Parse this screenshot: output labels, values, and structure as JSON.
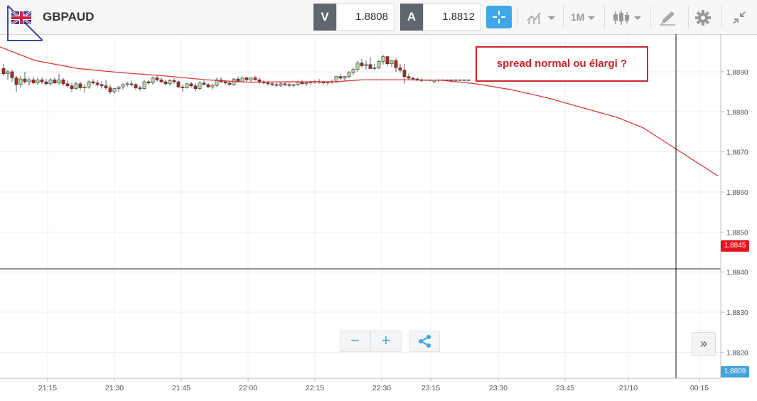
{
  "toolbar": {
    "symbol": "GBPAUD",
    "sell_tag": "V",
    "sell_price": "1.8808",
    "buy_tag": "A",
    "buy_price": "1.8812",
    "timeframe": "1M",
    "accent_color": "#3ea8e6"
  },
  "icons": [
    "uk-flag-icon",
    "crosshair-icon",
    "chart-type-icon",
    "candlestick-icon",
    "drawing-tool-icon",
    "gear-icon",
    "collapse-icon",
    "zoom-out-icon",
    "zoom-in-icon",
    "share-icon",
    "scroll-right-icon"
  ],
  "annotation": {
    "text": "spread normal ou élargi ?",
    "border_color": "#d0262d"
  },
  "zoom": {
    "minus": "−",
    "plus": "+"
  },
  "scroll_right": "»",
  "chart_data": {
    "type": "candlestick",
    "symbol": "GBPAUD",
    "timeframe": "1M",
    "x_tick_labels": [
      "21:15",
      "21:30",
      "21:45",
      "22:00",
      "22:15",
      "22:30",
      "23:15",
      "23:30",
      "23:45",
      "21/10",
      "00:15"
    ],
    "y_tick_labels": [
      "1,8890",
      "1,8880",
      "1,8870",
      "1,8860",
      "1,8850",
      "1,8840",
      "1,8830",
      "1,8820"
    ],
    "ylim": [
      1.88135,
      1.88994
    ],
    "up_color": "#b7d9a8",
    "down_color": "#b0291b",
    "ma_color": "#e03a36",
    "candles": [
      [
        1.88908,
        1.8892,
        1.8889,
        1.88895
      ],
      [
        1.88895,
        1.88905,
        1.8888,
        1.889
      ],
      [
        1.889,
        1.88905,
        1.88875,
        1.88885
      ],
      [
        1.88885,
        1.8889,
        1.8885,
        1.88868
      ],
      [
        1.88868,
        1.8889,
        1.8886,
        1.88882
      ],
      [
        1.88882,
        1.889,
        1.8887,
        1.88875
      ],
      [
        1.88875,
        1.88885,
        1.88865,
        1.8888
      ],
      [
        1.8888,
        1.88888,
        1.8887,
        1.88872
      ],
      [
        1.88872,
        1.88885,
        1.88868,
        1.8888
      ],
      [
        1.8888,
        1.88886,
        1.8887,
        1.88875
      ],
      [
        1.88875,
        1.88882,
        1.88866,
        1.8887
      ],
      [
        1.8887,
        1.88884,
        1.88865,
        1.8888
      ],
      [
        1.8888,
        1.88886,
        1.8887,
        1.88872
      ],
      [
        1.88872,
        1.88895,
        1.88868,
        1.8888
      ],
      [
        1.8888,
        1.88884,
        1.88865,
        1.8887
      ],
      [
        1.8887,
        1.88878,
        1.8886,
        1.88865
      ],
      [
        1.88865,
        1.88872,
        1.8885,
        1.88858
      ],
      [
        1.88858,
        1.88875,
        1.88855,
        1.8887
      ],
      [
        1.8887,
        1.88875,
        1.88855,
        1.8886
      ],
      [
        1.8886,
        1.88868,
        1.88848,
        1.88862
      ],
      [
        1.88862,
        1.88878,
        1.88858,
        1.88875
      ],
      [
        1.88875,
        1.88882,
        1.88868,
        1.88872
      ],
      [
        1.88872,
        1.8888,
        1.88862,
        1.88868
      ],
      [
        1.88868,
        1.88876,
        1.88858,
        1.88865
      ],
      [
        1.88865,
        1.8888,
        1.88855,
        1.8886
      ],
      [
        1.8886,
        1.88868,
        1.88845,
        1.8885
      ],
      [
        1.8885,
        1.8886,
        1.88845,
        1.88858
      ],
      [
        1.88858,
        1.88865,
        1.8885,
        1.88862
      ],
      [
        1.88862,
        1.88872,
        1.88856,
        1.88868
      ],
      [
        1.88868,
        1.88876,
        1.88862,
        1.8887
      ],
      [
        1.8887,
        1.88878,
        1.88862,
        1.88868
      ],
      [
        1.88868,
        1.88872,
        1.88855,
        1.8886
      ],
      [
        1.8886,
        1.88865,
        1.88852,
        1.88858
      ],
      [
        1.88858,
        1.8888,
        1.88855,
        1.88875
      ],
      [
        1.88875,
        1.8888,
        1.88868,
        1.88872
      ],
      [
        1.88872,
        1.88888,
        1.88868,
        1.88885
      ],
      [
        1.88885,
        1.88892,
        1.88875,
        1.8888
      ],
      [
        1.8888,
        1.88886,
        1.88872,
        1.88875
      ],
      [
        1.88875,
        1.8888,
        1.88866,
        1.8887
      ],
      [
        1.8887,
        1.88882,
        1.88865,
        1.88878
      ],
      [
        1.88878,
        1.88884,
        1.8887,
        1.88875
      ],
      [
        1.88875,
        1.88878,
        1.8886,
        1.88862
      ],
      [
        1.88862,
        1.88868,
        1.8885,
        1.8886
      ],
      [
        1.8886,
        1.88872,
        1.88858,
        1.8887
      ],
      [
        1.8887,
        1.88875,
        1.8886,
        1.88865
      ],
      [
        1.88865,
        1.88872,
        1.88852,
        1.88858
      ],
      [
        1.88858,
        1.88876,
        1.88855,
        1.88872
      ],
      [
        1.88872,
        1.88878,
        1.88866,
        1.88868
      ],
      [
        1.88868,
        1.88872,
        1.8886,
        1.88862
      ],
      [
        1.88862,
        1.8887,
        1.88856,
        1.88866
      ],
      [
        1.88866,
        1.88885,
        1.88862,
        1.8888
      ],
      [
        1.8888,
        1.88886,
        1.88872,
        1.88875
      ],
      [
        1.88875,
        1.8888,
        1.88868,
        1.88872
      ],
      [
        1.88872,
        1.88876,
        1.88866,
        1.88868
      ],
      [
        1.88868,
        1.88884,
        1.88865,
        1.88882
      ],
      [
        1.88882,
        1.88888,
        1.88872,
        1.88875
      ],
      [
        1.88875,
        1.88888,
        1.88872,
        1.88885
      ],
      [
        1.88885,
        1.88888,
        1.88876,
        1.8888
      ],
      [
        1.8888,
        1.88886,
        1.88874,
        1.88885
      ],
      [
        1.88885,
        1.8889,
        1.88878,
        1.8888
      ],
      [
        1.8888,
        1.88886,
        1.8887,
        1.88875
      ],
      [
        1.88875,
        1.8888,
        1.88868,
        1.88872
      ],
      [
        1.88872,
        1.88878,
        1.88865,
        1.8887
      ],
      [
        1.8887,
        1.88876,
        1.88864,
        1.88868
      ],
      [
        1.88868,
        1.88872,
        1.88862,
        1.88866
      ],
      [
        1.88866,
        1.88874,
        1.88862,
        1.8887
      ],
      [
        1.8887,
        1.88876,
        1.88864,
        1.88868
      ],
      [
        1.88868,
        1.88872,
        1.88862,
        1.88866
      ],
      [
        1.88866,
        1.8887,
        1.88862,
        1.88868
      ],
      [
        1.88868,
        1.88878,
        1.88864,
        1.88875
      ],
      [
        1.88875,
        1.8888,
        1.88868,
        1.8887
      ],
      [
        1.8887,
        1.88876,
        1.88864,
        1.88872
      ],
      [
        1.88872,
        1.88878,
        1.88868,
        1.88874
      ],
      [
        1.88874,
        1.8888,
        1.8887,
        1.88876
      ],
      [
        1.88876,
        1.88882,
        1.8887,
        1.88874
      ],
      [
        1.88874,
        1.88878,
        1.88868,
        1.88872
      ],
      [
        1.88872,
        1.88876,
        1.88866,
        1.88874
      ],
      [
        1.88874,
        1.8888,
        1.8887,
        1.88876
      ],
      [
        1.88876,
        1.8889,
        1.88872,
        1.88888
      ],
      [
        1.88888,
        1.88894,
        1.8888,
        1.88884
      ],
      [
        1.88884,
        1.8889,
        1.88876,
        1.88888
      ],
      [
        1.88888,
        1.88902,
        1.88884,
        1.88898
      ],
      [
        1.88898,
        1.8891,
        1.88892,
        1.88906
      ],
      [
        1.88906,
        1.88928,
        1.889,
        1.88922
      ],
      [
        1.88922,
        1.88932,
        1.8891,
        1.88915
      ],
      [
        1.88915,
        1.88928,
        1.88905,
        1.88918
      ],
      [
        1.88918,
        1.88936,
        1.88912,
        1.88908
      ],
      [
        1.88908,
        1.8892,
        1.88904,
        1.8891
      ],
      [
        1.8891,
        1.8893,
        1.88906,
        1.88926
      ],
      [
        1.88926,
        1.88942,
        1.88918,
        1.88938
      ],
      [
        1.88938,
        1.8894,
        1.88914,
        1.8892
      ],
      [
        1.8892,
        1.8893,
        1.88912,
        1.88928
      ],
      [
        1.88928,
        1.88934,
        1.889,
        1.8891
      ],
      [
        1.8891,
        1.8892,
        1.88898,
        1.88904
      ],
      [
        1.88904,
        1.8892,
        1.8887,
        1.88888
      ],
      [
        1.88888,
        1.88896,
        1.8888,
        1.88884
      ],
      [
        1.88884,
        1.88888,
        1.88878,
        1.88882
      ],
      [
        1.88882,
        1.88886,
        1.88876,
        1.8888
      ],
      [
        1.8888,
        1.88884,
        1.88874,
        1.88878
      ],
      [
        1.8888,
        1.8888,
        1.88878,
        1.88879
      ],
      [
        1.8888,
        1.8888,
        1.88877,
        1.88878
      ],
      [
        1.88875,
        1.8888,
        1.88871,
        1.88879
      ],
      [
        1.8888,
        1.88881,
        1.88873,
        1.8888
      ],
      [
        1.8888,
        1.8888,
        1.88878,
        1.88879
      ],
      [
        1.8888,
        1.8888,
        1.88877,
        1.88879
      ],
      [
        1.8888,
        1.8888,
        1.88878,
        1.88879
      ],
      [
        1.8888,
        1.8888,
        1.88878,
        1.88879
      ],
      [
        1.8888,
        1.8888,
        1.88878,
        1.88879
      ],
      [
        1.8888,
        1.8888,
        1.88878,
        1.88879
      ],
      [
        1.8888,
        1.8888,
        1.88878,
        1.88879
      ]
    ],
    "ma": [
      [
        0,
        1.88962
      ],
      [
        50,
        1.88928
      ],
      [
        110,
        1.88908
      ],
      [
        170,
        1.88898
      ],
      [
        230,
        1.8889
      ],
      [
        290,
        1.8888
      ],
      [
        350,
        1.88874
      ],
      [
        410,
        1.88875
      ],
      [
        470,
        1.88875
      ],
      [
        510,
        1.8888
      ],
      [
        570,
        1.8888
      ],
      [
        620,
        1.88879
      ],
      [
        670,
        1.8887
      ],
      [
        720,
        1.88855
      ],
      [
        770,
        1.88835
      ],
      [
        820,
        1.8881
      ],
      [
        870,
        1.88785
      ],
      [
        905,
        1.8876
      ],
      [
        940,
        1.8872
      ],
      [
        975,
        1.8868
      ],
      [
        1010,
        1.8864
      ]
    ],
    "current_line": 1.88408,
    "last_price_label": "1,8845",
    "bid_price_label": "1,8809"
  },
  "chart_data_note_candles_visible": 0
}
